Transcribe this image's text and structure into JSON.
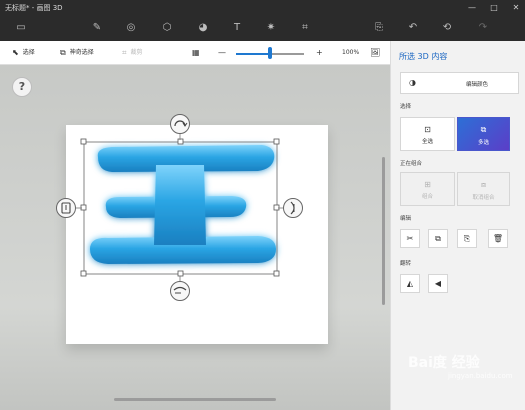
{
  "window": {
    "title": "无标题* - 画图 3D",
    "controls": [
      "—",
      "□",
      "✕"
    ]
  },
  "commandbar": {
    "tools": [
      {
        "name": "menu-icon",
        "glyph": "▭"
      },
      {
        "name": "brushes-icon",
        "glyph": "✎"
      },
      {
        "name": "2d-shapes-icon",
        "glyph": "◎"
      },
      {
        "name": "3d-shapes-icon",
        "glyph": "⬡"
      },
      {
        "name": "stickers-icon",
        "glyph": "◕"
      },
      {
        "name": "text-icon",
        "glyph": "T"
      },
      {
        "name": "effects-icon",
        "glyph": "✷"
      },
      {
        "name": "canvas-icon",
        "glyph": "⌗"
      },
      {
        "name": "paste-icon",
        "glyph": "⎘"
      },
      {
        "name": "undo-icon",
        "glyph": "↶"
      },
      {
        "name": "history-icon",
        "glyph": "⟲"
      },
      {
        "name": "redo-icon",
        "glyph": "↷"
      }
    ]
  },
  "toolbar": {
    "select": "选择",
    "magic_select": "神奇选择",
    "crop": "裁剪",
    "zoom_minus": "—",
    "zoom_plus": "+",
    "zoom_value": "100%",
    "zoom_level": 0.5
  },
  "canvas": {
    "help": "?",
    "text_shape": "王",
    "shape_color": "#2aa5e4"
  },
  "panel": {
    "title": "所选 3D 内容",
    "edit_color": "编辑颜色",
    "select_label": "选择",
    "select_all": "全选",
    "multi_select": "多选",
    "grouping_label": "正在组合",
    "group": "组合",
    "ungroup": "取消组合",
    "edit_label": "编辑",
    "edit_icons": [
      "cut-icon",
      "copy-icon",
      "paste-icon",
      "delete-icon"
    ],
    "flip_label": "翻转",
    "flip_icons": [
      "flip-horizontal-icon",
      "flip-vertical-icon"
    ]
  },
  "watermark": {
    "brand": "Bai度 经验",
    "url": "jingyan.baidu.com"
  },
  "colors": {
    "accent": "#1e78d0",
    "multi_select_active": "#3d5fd2",
    "titlebar": "#2b2b2b"
  }
}
